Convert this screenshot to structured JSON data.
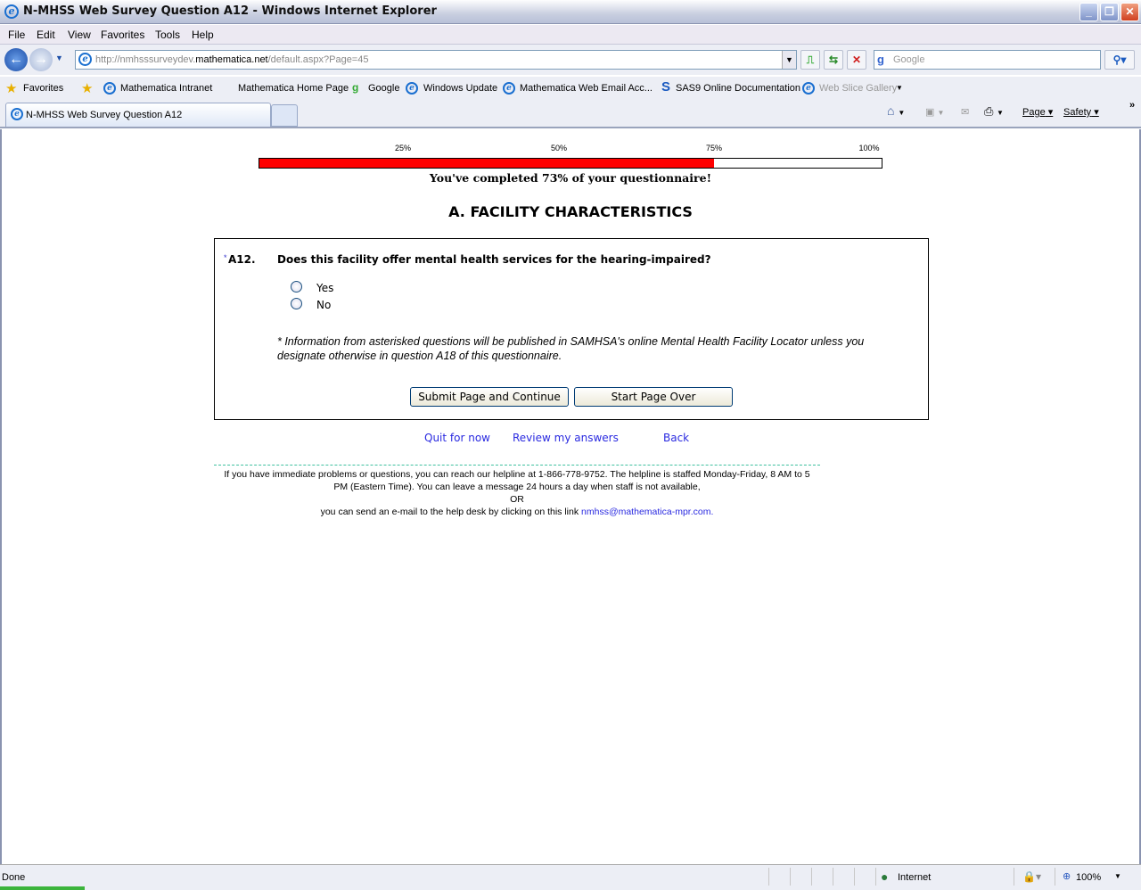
{
  "window": {
    "title": "N-MHSS Web Survey Question A12 - Windows Internet Explorer"
  },
  "menu": [
    "File",
    "Edit",
    "View",
    "Favorites",
    "Tools",
    "Help"
  ],
  "address": {
    "prefix": "http://nmhsssurveydev.",
    "domain": "mathematica.net",
    "path": "/default.aspx?Page=45"
  },
  "search": {
    "placeholder": "Google"
  },
  "favorites": {
    "label": "Favorites",
    "items": [
      "Mathematica Intranet",
      "Mathematica Home Page",
      "Google",
      "Windows Update",
      "Mathematica Web Email Acc...",
      "SAS9 Online Documentation",
      "Web Slice Gallery"
    ]
  },
  "tab": {
    "title": "N-MHSS Web Survey Question A12"
  },
  "commands": {
    "page": "Page",
    "safety": "Safety"
  },
  "progress": {
    "ticks": [
      "25%",
      "50%",
      "75%",
      "100%"
    ],
    "percent": 73,
    "message": "You've completed 73% of your questionnaire!"
  },
  "section": "A. FACILITY CHARACTERISTICS",
  "question": {
    "asterisk": "*",
    "number": "A12.",
    "text": "Does this facility offer mental health services for the hearing-impaired?",
    "options": [
      "Yes",
      "No"
    ],
    "note": "* Information from asterisked questions will be published in SAMHSA's online Mental Health Facility Locator unless you designate otherwise in question A18 of this questionnaire."
  },
  "buttons": {
    "submit": "Submit Page and Continue",
    "restart": "Start Page Over"
  },
  "links": {
    "quit": "Quit for now",
    "review": "Review my answers",
    "back": "Back"
  },
  "footer": {
    "line1": "If you have immediate problems or questions, you can reach our helpline at 1-866-778-9752. The helpline is staffed Monday-Friday, 8 AM to 5",
    "line2": "PM (Eastern Time). You can leave a message 24 hours a day when staff is not available,",
    "or": "OR",
    "line4": "you can send an e-mail to the help desk by clicking on this link",
    "email": "nmhss@mathematica-mpr.com."
  },
  "status": {
    "text": "Done",
    "zone": "Internet",
    "zoom": "100%"
  }
}
